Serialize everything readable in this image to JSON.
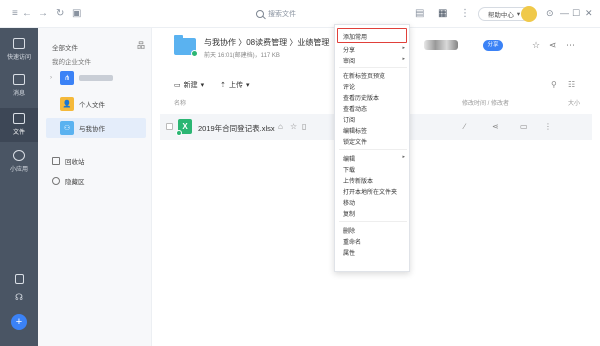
{
  "topbar": {
    "search_placeholder": "搜索文件",
    "help_label": "帮助中心"
  },
  "rail": {
    "items": [
      {
        "label": "快速访问"
      },
      {
        "label": "消息"
      },
      {
        "label": "文件"
      },
      {
        "label": "小应用"
      }
    ]
  },
  "sidebar": {
    "all_files": "全部文件",
    "my_enterprise": "我的企业文件",
    "personal": "个人文件",
    "collab": "与我协作",
    "recycle": "回收站",
    "private": "隐藏区"
  },
  "header": {
    "breadcrumb": "与我协作 〉08读费管理 〉业绩管理",
    "meta": "前天 16:01(邮建档)，117 KB",
    "share_label": "分享"
  },
  "toolbar": {
    "new_label": "新建",
    "upload_label": "上传"
  },
  "list": {
    "col_name": "名称",
    "col_time": "修改时间 / 修改者",
    "col_size": "大小",
    "files": [
      {
        "name": "2019年合同登记表.xlsx"
      }
    ]
  },
  "context_menu": {
    "items": [
      {
        "label": "添加常用",
        "submenu": false
      },
      {
        "label": "分享",
        "submenu": true
      },
      {
        "label": "审阅",
        "submenu": true
      },
      {
        "label": "在新标签页预览",
        "submenu": false
      },
      {
        "label": "评论",
        "submenu": false
      },
      {
        "label": "查看历史版本",
        "submenu": false
      },
      {
        "label": "查看动态",
        "submenu": false
      },
      {
        "label": "订阅",
        "submenu": false
      },
      {
        "label": "编辑标签",
        "submenu": false
      },
      {
        "label": "锁定文件",
        "submenu": false
      },
      {
        "label": "编辑",
        "submenu": true
      },
      {
        "label": "下载",
        "submenu": false
      },
      {
        "label": "上传新版本",
        "submenu": false
      },
      {
        "label": "打开本地所在文件夹",
        "submenu": false
      },
      {
        "label": "移动",
        "submenu": false
      },
      {
        "label": "复制",
        "submenu": false
      },
      {
        "label": "删除",
        "submenu": false
      },
      {
        "label": "重命名",
        "submenu": false
      },
      {
        "label": "属性",
        "submenu": false
      }
    ]
  }
}
